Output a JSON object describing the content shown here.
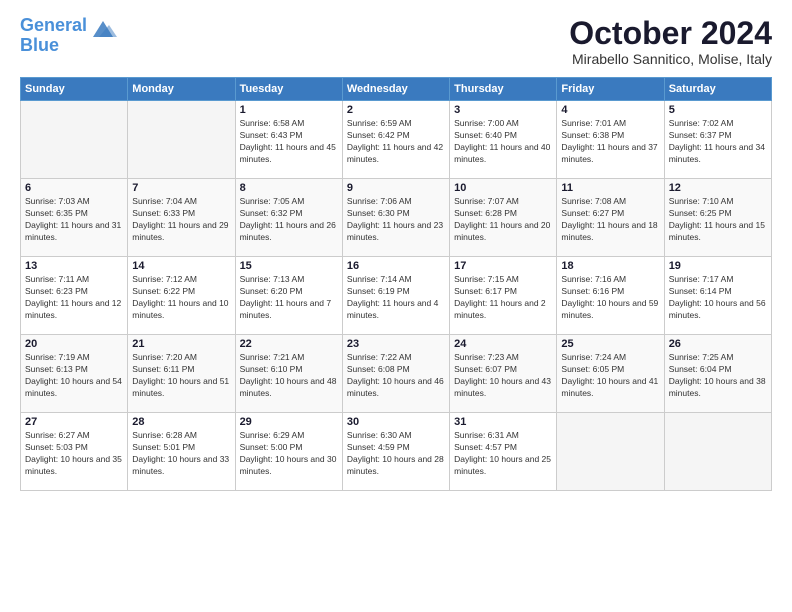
{
  "logo": {
    "line1": "General",
    "line2": "Blue"
  },
  "title": "October 2024",
  "subtitle": "Mirabello Sannitico, Molise, Italy",
  "headers": [
    "Sunday",
    "Monday",
    "Tuesday",
    "Wednesday",
    "Thursday",
    "Friday",
    "Saturday"
  ],
  "weeks": [
    [
      {
        "day": "",
        "info": ""
      },
      {
        "day": "",
        "info": ""
      },
      {
        "day": "1",
        "info": "Sunrise: 6:58 AM\nSunset: 6:43 PM\nDaylight: 11 hours and 45 minutes."
      },
      {
        "day": "2",
        "info": "Sunrise: 6:59 AM\nSunset: 6:42 PM\nDaylight: 11 hours and 42 minutes."
      },
      {
        "day": "3",
        "info": "Sunrise: 7:00 AM\nSunset: 6:40 PM\nDaylight: 11 hours and 40 minutes."
      },
      {
        "day": "4",
        "info": "Sunrise: 7:01 AM\nSunset: 6:38 PM\nDaylight: 11 hours and 37 minutes."
      },
      {
        "day": "5",
        "info": "Sunrise: 7:02 AM\nSunset: 6:37 PM\nDaylight: 11 hours and 34 minutes."
      }
    ],
    [
      {
        "day": "6",
        "info": "Sunrise: 7:03 AM\nSunset: 6:35 PM\nDaylight: 11 hours and 31 minutes."
      },
      {
        "day": "7",
        "info": "Sunrise: 7:04 AM\nSunset: 6:33 PM\nDaylight: 11 hours and 29 minutes."
      },
      {
        "day": "8",
        "info": "Sunrise: 7:05 AM\nSunset: 6:32 PM\nDaylight: 11 hours and 26 minutes."
      },
      {
        "day": "9",
        "info": "Sunrise: 7:06 AM\nSunset: 6:30 PM\nDaylight: 11 hours and 23 minutes."
      },
      {
        "day": "10",
        "info": "Sunrise: 7:07 AM\nSunset: 6:28 PM\nDaylight: 11 hours and 20 minutes."
      },
      {
        "day": "11",
        "info": "Sunrise: 7:08 AM\nSunset: 6:27 PM\nDaylight: 11 hours and 18 minutes."
      },
      {
        "day": "12",
        "info": "Sunrise: 7:10 AM\nSunset: 6:25 PM\nDaylight: 11 hours and 15 minutes."
      }
    ],
    [
      {
        "day": "13",
        "info": "Sunrise: 7:11 AM\nSunset: 6:23 PM\nDaylight: 11 hours and 12 minutes."
      },
      {
        "day": "14",
        "info": "Sunrise: 7:12 AM\nSunset: 6:22 PM\nDaylight: 11 hours and 10 minutes."
      },
      {
        "day": "15",
        "info": "Sunrise: 7:13 AM\nSunset: 6:20 PM\nDaylight: 11 hours and 7 minutes."
      },
      {
        "day": "16",
        "info": "Sunrise: 7:14 AM\nSunset: 6:19 PM\nDaylight: 11 hours and 4 minutes."
      },
      {
        "day": "17",
        "info": "Sunrise: 7:15 AM\nSunset: 6:17 PM\nDaylight: 11 hours and 2 minutes."
      },
      {
        "day": "18",
        "info": "Sunrise: 7:16 AM\nSunset: 6:16 PM\nDaylight: 10 hours and 59 minutes."
      },
      {
        "day": "19",
        "info": "Sunrise: 7:17 AM\nSunset: 6:14 PM\nDaylight: 10 hours and 56 minutes."
      }
    ],
    [
      {
        "day": "20",
        "info": "Sunrise: 7:19 AM\nSunset: 6:13 PM\nDaylight: 10 hours and 54 minutes."
      },
      {
        "day": "21",
        "info": "Sunrise: 7:20 AM\nSunset: 6:11 PM\nDaylight: 10 hours and 51 minutes."
      },
      {
        "day": "22",
        "info": "Sunrise: 7:21 AM\nSunset: 6:10 PM\nDaylight: 10 hours and 48 minutes."
      },
      {
        "day": "23",
        "info": "Sunrise: 7:22 AM\nSunset: 6:08 PM\nDaylight: 10 hours and 46 minutes."
      },
      {
        "day": "24",
        "info": "Sunrise: 7:23 AM\nSunset: 6:07 PM\nDaylight: 10 hours and 43 minutes."
      },
      {
        "day": "25",
        "info": "Sunrise: 7:24 AM\nSunset: 6:05 PM\nDaylight: 10 hours and 41 minutes."
      },
      {
        "day": "26",
        "info": "Sunrise: 7:25 AM\nSunset: 6:04 PM\nDaylight: 10 hours and 38 minutes."
      }
    ],
    [
      {
        "day": "27",
        "info": "Sunrise: 6:27 AM\nSunset: 5:03 PM\nDaylight: 10 hours and 35 minutes."
      },
      {
        "day": "28",
        "info": "Sunrise: 6:28 AM\nSunset: 5:01 PM\nDaylight: 10 hours and 33 minutes."
      },
      {
        "day": "29",
        "info": "Sunrise: 6:29 AM\nSunset: 5:00 PM\nDaylight: 10 hours and 30 minutes."
      },
      {
        "day": "30",
        "info": "Sunrise: 6:30 AM\nSunset: 4:59 PM\nDaylight: 10 hours and 28 minutes."
      },
      {
        "day": "31",
        "info": "Sunrise: 6:31 AM\nSunset: 4:57 PM\nDaylight: 10 hours and 25 minutes."
      },
      {
        "day": "",
        "info": ""
      },
      {
        "day": "",
        "info": ""
      }
    ]
  ]
}
